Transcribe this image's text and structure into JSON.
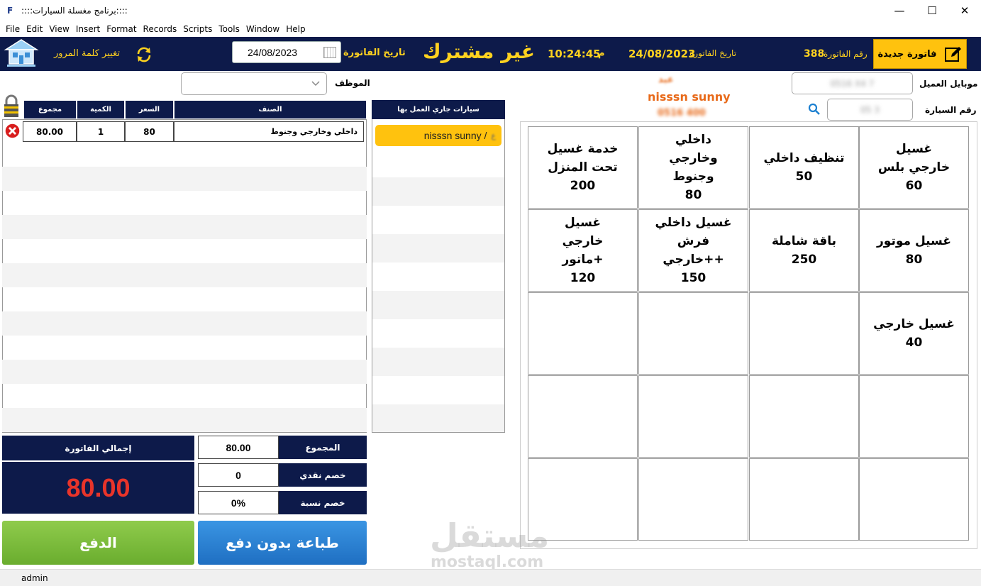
{
  "window": {
    "title": "::::برنامج مغسلة السيارات::::",
    "app_icon": "F",
    "controls": [
      "—",
      "☐",
      "✕"
    ]
  },
  "menu": [
    "File",
    "Edit",
    "View",
    "Insert",
    "Format",
    "Records",
    "Scripts",
    "Tools",
    "Window",
    "Help"
  ],
  "header": {
    "new_invoice_label": "فاتورة جديدة",
    "invoice_number_label": "رقم الفاتورة",
    "invoice_number": "388",
    "invoice_date_label": "تاريخ الفاتورة",
    "invoice_date": "24/08/2023",
    "time": "10:24:45",
    "time_period": "م",
    "subscription_status": "غير مشترك",
    "date_field_label": "تاريخ الفاتورة",
    "date_field_value": "24/08/2023",
    "change_password_label": "تغيير كلمة المرور"
  },
  "customer": {
    "mobile_label": "موبايل العميل",
    "mobile_value": "0516 X4 7",
    "car_number_label": "رقم السيارة",
    "car_number_value": "05 3",
    "name_top": "عبد",
    "car_model": "nisssn sunny",
    "phone_bottom": "0516 400",
    "employee_label": "الموظف",
    "employee_value": ""
  },
  "items_table": {
    "headers": {
      "item": "الصنف",
      "price": "السعر",
      "qty": "الكمية",
      "total": "مجموع"
    },
    "rows": [
      {
        "item": "داخلي وخارجي وجنوط",
        "price": "80",
        "qty": "1",
        "total": "80.00"
      }
    ]
  },
  "cars_in_progress": {
    "header": "سيارات جاري العمل بها",
    "items": [
      {
        "car": "nisssn sunny /",
        "customer": "ع"
      }
    ]
  },
  "services": [
    {
      "name": "غسيل خارجي بلس",
      "price": "60"
    },
    {
      "name": "تنظيف داخلي",
      "price": "50"
    },
    {
      "name": "داخلي وخارجي وجنوط",
      "price": "80"
    },
    {
      "name": "خدمة غسيل تحت المنزل",
      "price": "200"
    },
    {
      "name": "غسيل موتور",
      "price": "80"
    },
    {
      "name": "باقة شاملة",
      "price": "250"
    },
    {
      "name": "غسيل داخلي فرش +خارجي+",
      "price": "150"
    },
    {
      "name": "غسيل خارجي ماتور+",
      "price": "120"
    },
    {
      "name": "غسيل خارجي",
      "price": "40"
    }
  ],
  "totals": {
    "invoice_total_label": "إجمالي الفاتورة",
    "invoice_total": "80.00",
    "sum_label": "المجموع",
    "sum_value": "80.00",
    "cash_discount_label": "خصم نقدي",
    "cash_discount_value": "0",
    "percent_discount_label": "خصم نسبة",
    "percent_discount_value": "0%"
  },
  "actions": {
    "pay_label": "الدفع",
    "print_label": "طباعة بدون دفع"
  },
  "watermark": {
    "arabic": "مستقل",
    "latin": "mostaql.com"
  },
  "status_bar": {
    "user": "admin"
  },
  "colors": {
    "navy": "#0d1a4a",
    "gold": "#ffd21f",
    "orange": "#ffc20e",
    "red_total": "#e8342a",
    "green": "#7ab83a",
    "blue": "#2a7fd0"
  }
}
